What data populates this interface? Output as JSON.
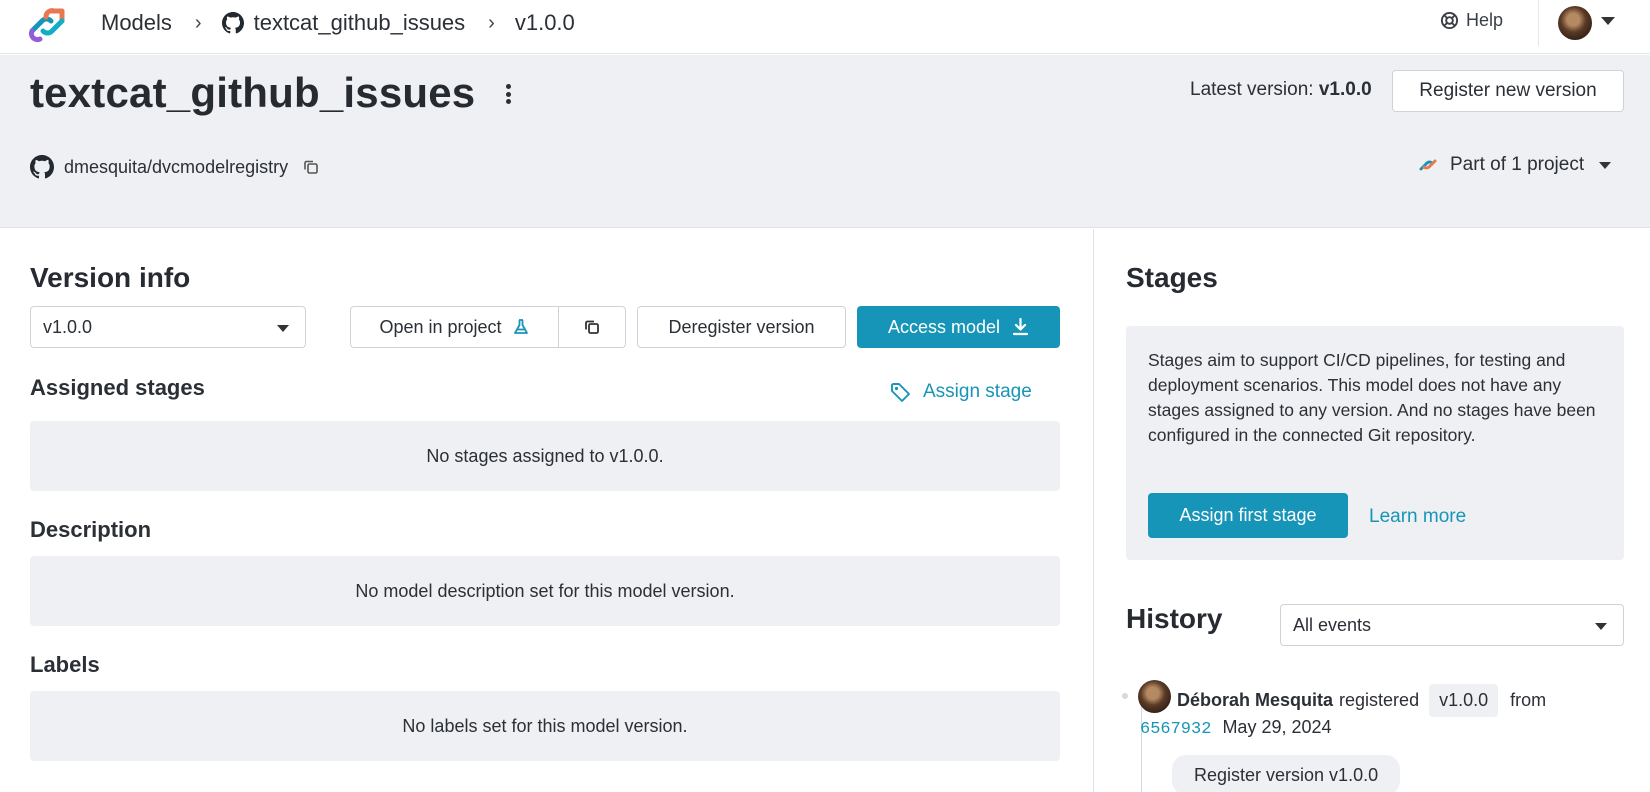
{
  "colors": {
    "accent": "#1795b8",
    "panel_bg": "#eef0f3",
    "text": "#2b2f36"
  },
  "nav": {
    "breadcrumbs": [
      {
        "label": "Models"
      },
      {
        "label": "textcat_github_issues",
        "icon": "github-icon"
      },
      {
        "label": "v1.0.0"
      }
    ],
    "help_label": "Help"
  },
  "header": {
    "title": "textcat_github_issues",
    "latest_label": "Latest version:",
    "latest_value": "v1.0.0",
    "register_button": "Register new version",
    "repo": "dmesquita/dvcmodelregistry",
    "part_of": "Part of 1 project"
  },
  "version_info": {
    "heading": "Version info",
    "selected_version": "v1.0.0",
    "open_in_project": "Open in project",
    "deregister": "Deregister version",
    "access_model": "Access model"
  },
  "assigned_stages": {
    "heading": "Assigned stages",
    "assign_link": "Assign stage",
    "empty": "No stages assigned to v1.0.0."
  },
  "description": {
    "heading": "Description",
    "empty": "No model description set for this model version."
  },
  "labels": {
    "heading": "Labels",
    "empty": "No labels set for this model version."
  },
  "stages": {
    "heading": "Stages",
    "text": "Stages aim to support CI/CD pipelines, for testing and deployment scenarios. This model does not have any stages assigned to any version. And no stages have been configured in the connected Git repository.",
    "assign_first": "Assign first stage",
    "learn_more": "Learn more"
  },
  "history": {
    "heading": "History",
    "filter": "All events",
    "events": [
      {
        "user": "Déborah Mesquita",
        "action": "registered",
        "version": "v1.0.0",
        "from": "from",
        "commit": "6567932",
        "date": "May 29, 2024",
        "message": "Register version v1.0.0"
      }
    ]
  }
}
